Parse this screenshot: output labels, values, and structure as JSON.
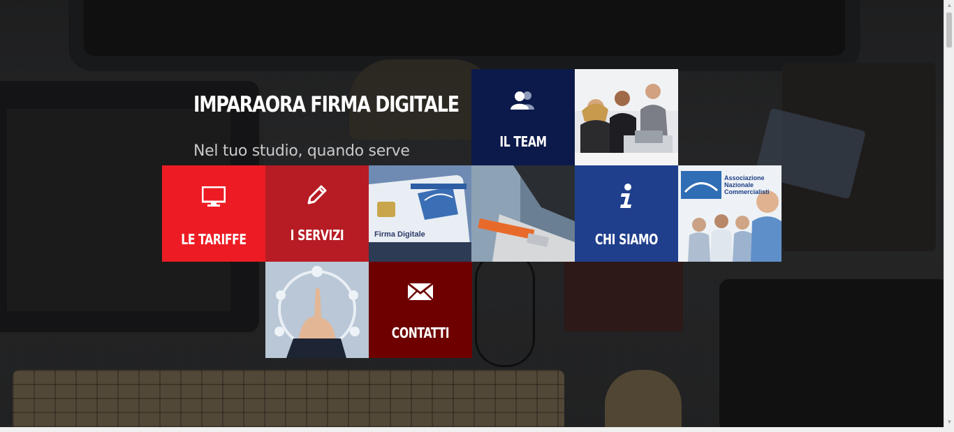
{
  "hero": {
    "title": "IMPARAORA FIRMA DIGITALE",
    "subtitle": "Nel tuo studio, quando serve"
  },
  "tiles": {
    "team": {
      "label": "IL TEAM",
      "color": "#0b1a4a",
      "icon": "users-icon"
    },
    "tariffe": {
      "label": "LE TARIFFE",
      "color": "#ed1c24",
      "icon": "monitor-icon"
    },
    "servizi": {
      "label": "I SERVIZI",
      "color": "#b71c24",
      "icon": "pencil-icon"
    },
    "chi_siamo": {
      "label": "CHI SIAMO",
      "color": "#1f3e8c",
      "icon": "info-icon"
    },
    "contatti": {
      "label": "CONTATTI",
      "color": "#6e0000",
      "icon": "envelope-icon"
    }
  },
  "photos": {
    "card_text": "Firma Digitale",
    "anc_title": "Associazione Nazionale Commercialisti"
  }
}
